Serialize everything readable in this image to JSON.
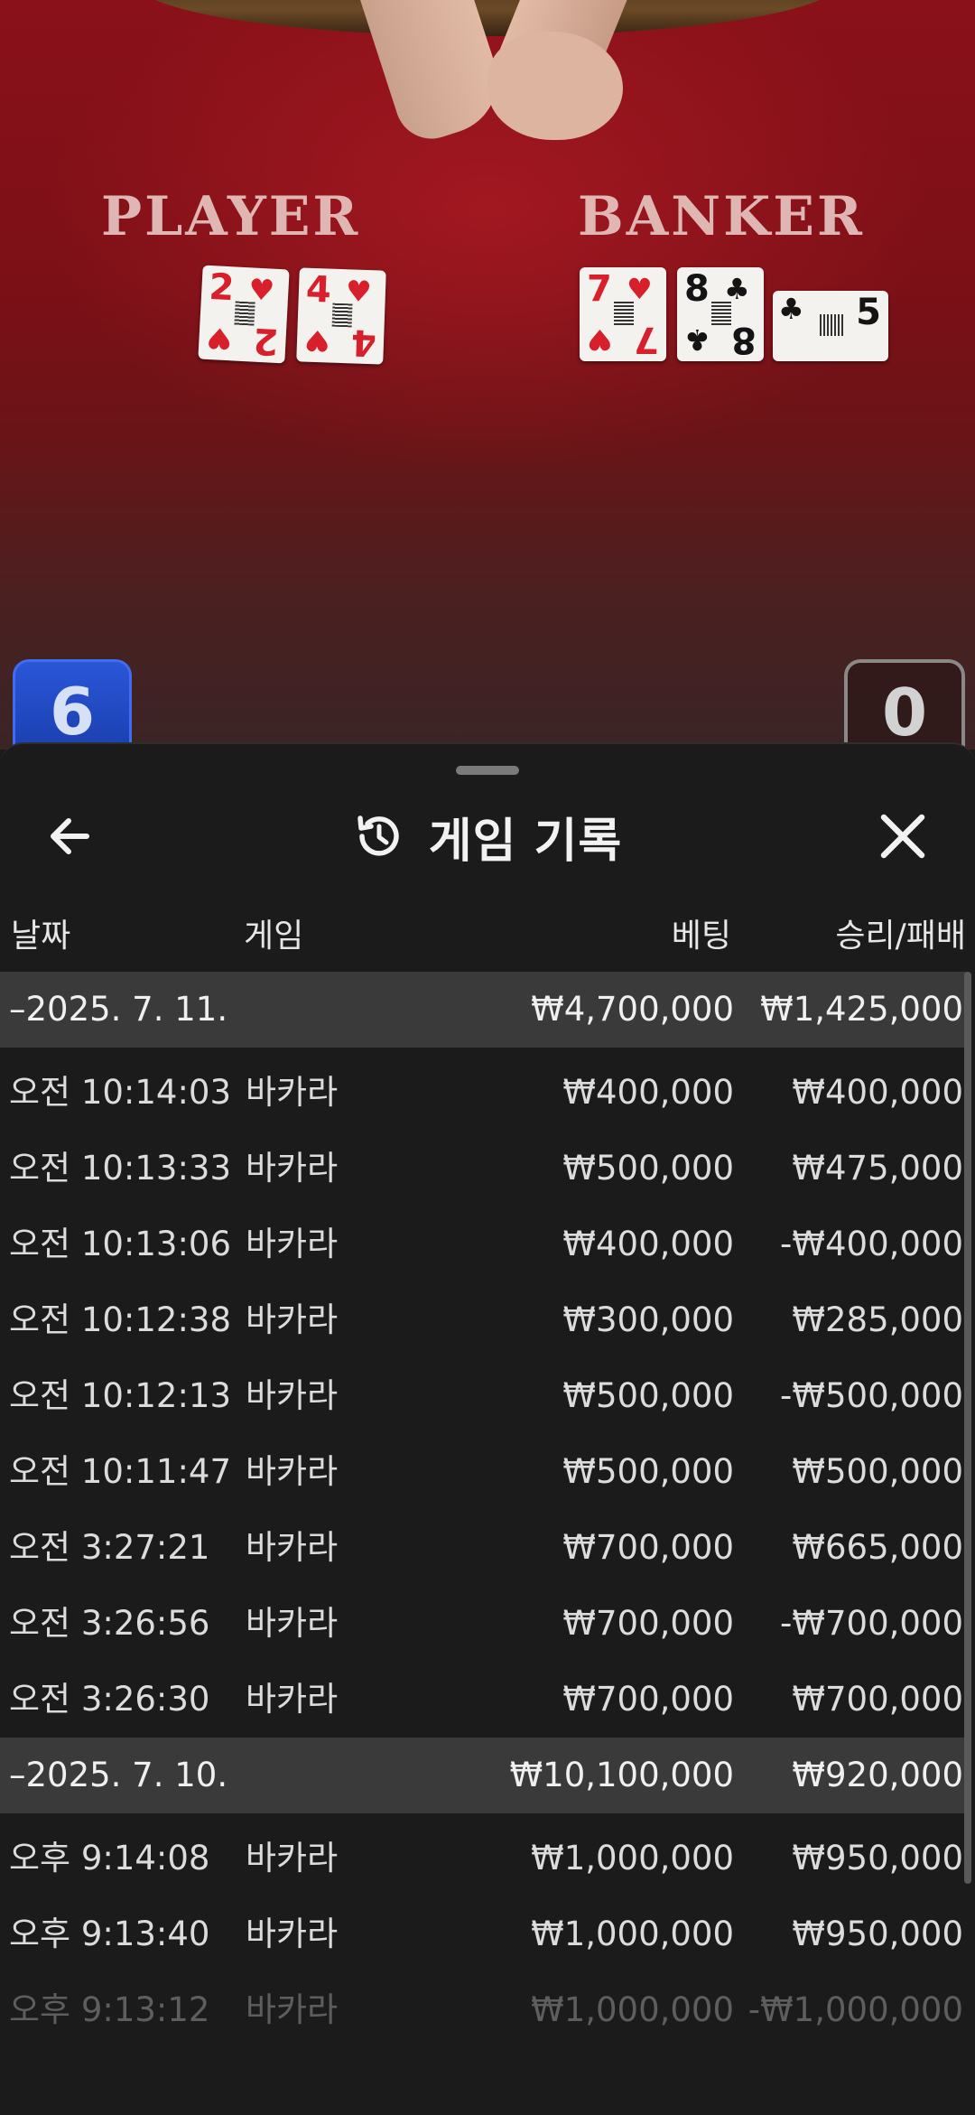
{
  "table": {
    "player_label": "PLAYER",
    "banker_label": "BANKER",
    "player_cards": [
      {
        "rank": "2",
        "suit": "♥",
        "color": "#d8202c"
      },
      {
        "rank": "4",
        "suit": "♥",
        "color": "#d8202c"
      }
    ],
    "banker_cards": [
      {
        "rank": "7",
        "suit": "♥",
        "color": "#d8202c"
      },
      {
        "rank": "8",
        "suit": "♣",
        "color": "#141414"
      },
      {
        "rank": "5",
        "suit": "♣",
        "color": "#141414"
      }
    ],
    "player_score": "6",
    "banker_score": "0"
  },
  "sheet": {
    "title": "게임 기록",
    "icons": {
      "back": "arrow-left-icon",
      "history": "history-icon",
      "close": "close-icon"
    },
    "columns": {
      "date": "날짜",
      "game": "게임",
      "bet": "베팅",
      "result": "승리/패배"
    },
    "groups": [
      {
        "date": "–2025. 7. 11.",
        "bet_total": "₩4,700,000",
        "result_total": "₩1,425,000",
        "rows": [
          {
            "time": "오전 10:14:03",
            "game": "바카라",
            "bet": "₩400,000",
            "result": "₩400,000"
          },
          {
            "time": "오전 10:13:33",
            "game": "바카라",
            "bet": "₩500,000",
            "result": "₩475,000"
          },
          {
            "time": "오전 10:13:06",
            "game": "바카라",
            "bet": "₩400,000",
            "result": "-₩400,000"
          },
          {
            "time": "오전 10:12:38",
            "game": "바카라",
            "bet": "₩300,000",
            "result": "₩285,000"
          },
          {
            "time": "오전 10:12:13",
            "game": "바카라",
            "bet": "₩500,000",
            "result": "-₩500,000"
          },
          {
            "time": "오전 10:11:47",
            "game": "바카라",
            "bet": "₩500,000",
            "result": "₩500,000"
          },
          {
            "time": "오전 3:27:21",
            "game": "바카라",
            "bet": "₩700,000",
            "result": "₩665,000"
          },
          {
            "time": "오전 3:26:56",
            "game": "바카라",
            "bet": "₩700,000",
            "result": "-₩700,000"
          },
          {
            "time": "오전 3:26:30",
            "game": "바카라",
            "bet": "₩700,000",
            "result": "₩700,000"
          }
        ]
      },
      {
        "date": "–2025. 7. 10.",
        "bet_total": "₩10,100,000",
        "result_total": "₩920,000",
        "rows": [
          {
            "time": "오후 9:14:08",
            "game": "바카라",
            "bet": "₩1,000,000",
            "result": "₩950,000"
          },
          {
            "time": "오후 9:13:40",
            "game": "바카라",
            "bet": "₩1,000,000",
            "result": "₩950,000"
          },
          {
            "time": "오후 9:13:12",
            "game": "바카라",
            "bet": "₩1,000,000",
            "result": "-₩1,000,000"
          }
        ]
      }
    ]
  }
}
